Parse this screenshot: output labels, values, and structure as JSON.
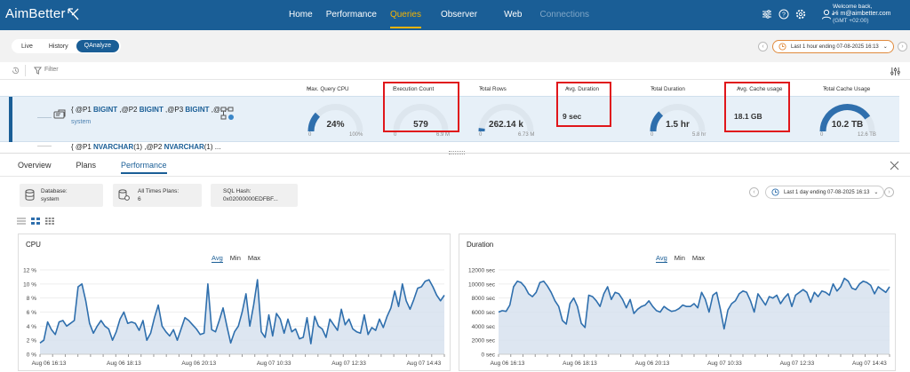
{
  "app": {
    "logo": "AimBetter"
  },
  "nav": [
    {
      "label": "Home"
    },
    {
      "label": "Performance"
    },
    {
      "label": "Queries"
    },
    {
      "label": "Observer"
    },
    {
      "label": "Web"
    },
    {
      "label": "Connections"
    }
  ],
  "user": {
    "welcome": "Welcome back,",
    "name": "Hi m@aimbetter.com",
    "tz": "(GMT +02:00)"
  },
  "tabs": [
    {
      "label": "Live"
    },
    {
      "label": "History"
    },
    {
      "label": "QAnalyze"
    }
  ],
  "time_range": "Last 1 hour ending  07-08-2025 16:13",
  "filter_label": "Filter",
  "columns": [
    "Max. Query CPU",
    "Execution Count",
    "Total Rows",
    "Avg. Duration",
    "Total Duration",
    "Avg. Cache usage",
    "Total Cache Usage"
  ],
  "row1": {
    "q1": "{ @P1 ",
    "k1": "BIGINT",
    "q2": " ,@P2 ",
    "k2": "BIGINT",
    "q3": " ,@P3 ",
    "k3": "BIGINT",
    "q4": " ,@...",
    "db": "system",
    "cpu": {
      "value": "24%",
      "min": "0",
      "max": "100%",
      "fraction": 0.24
    },
    "exec": {
      "value": "579",
      "min": "0",
      "max": "6.9 M",
      "fraction": 0.0
    },
    "rows": {
      "value": "262.14 k",
      "min": "0",
      "max": "6.73 M",
      "fraction": 0.04
    },
    "avgdur": {
      "value": "9 sec"
    },
    "totdur": {
      "value": "1.5 hr",
      "min": "0",
      "max": "5.8 hr",
      "fraction": 0.26
    },
    "avgcache": {
      "value": "18.1 GB"
    },
    "totcache": {
      "value": "10.2 TB",
      "min": "0",
      "max": "12.6 TB",
      "fraction": 0.81
    }
  },
  "row2": {
    "q1": "{ @P1 ",
    "k1": "NVARCHAR",
    "q2": "(1) ,@P2 ",
    "k2": "NVARCHAR",
    "q3": "(1) ..."
  },
  "panel": {
    "tabs": [
      {
        "label": "Overview"
      },
      {
        "label": "Plans"
      },
      {
        "label": "Performance"
      }
    ],
    "db_label": "Database:",
    "db_value": "system",
    "plans_label": "All Times Plans:",
    "plans_value": "6",
    "hash_label": "SQL Hash:",
    "hash_value": "0x02000000EDFBF...",
    "range": "Last 1 day ending  07-08-2025 16:13"
  },
  "charts": [
    {
      "title": "CPU",
      "tabs": [
        "Avg",
        "Min",
        "Max"
      ]
    },
    {
      "title": "Duration",
      "tabs": [
        "Avg",
        "Min",
        "Max"
      ]
    }
  ],
  "chart_data": [
    {
      "type": "area",
      "title": "CPU",
      "series": [
        {
          "values": [
            1.6,
            2,
            4.6,
            3.5,
            2.8,
            4.6,
            4.8,
            4,
            4.4,
            4.8,
            9.6,
            10,
            7.6,
            4.4,
            3,
            4,
            4.8,
            4,
            3.6,
            2,
            3.2,
            5,
            6,
            4.4,
            4.6,
            4.4,
            3.4,
            4.8,
            2,
            3,
            5.2,
            7,
            4,
            3.2,
            2.6,
            3.5,
            2,
            3.6,
            5.2,
            4.8,
            4.2,
            3.6,
            2.8,
            3,
            10,
            3.5,
            3.2,
            4.8,
            6.6,
            4,
            1.6,
            3.2,
            4,
            6,
            8.6,
            4,
            7,
            10.6,
            3.2,
            2.4,
            5.6,
            2.6,
            5.8,
            5,
            3,
            5,
            3.2,
            3.6,
            2.2,
            2.4,
            5.2,
            1.5,
            5.4,
            4,
            3.6,
            2.4,
            5,
            4.2,
            3.4,
            6.4,
            4.2,
            5,
            3.6,
            3.2,
            3,
            5.6,
            2.8,
            3.8,
            3.4,
            5,
            3.8,
            5.4,
            6.6,
            9,
            6.8,
            10,
            7.6,
            6.4,
            7.8,
            9.4,
            9.6,
            10.4,
            10.6,
            9.6,
            8.4,
            7.6,
            8.4
          ]
        }
      ],
      "xlabels": [
        "Aug 06 16:13",
        "Aug 06 18:13",
        "Aug 06 20:13",
        "Aug 07 10:33",
        "Aug 07 12:33",
        "Aug 07 14:43"
      ],
      "ylabels": [
        "0 %",
        "2 %",
        "4 %",
        "6 %",
        "8 %",
        "10 %",
        "12 %"
      ],
      "ylim": [
        0,
        12
      ]
    },
    {
      "type": "area",
      "title": "Duration",
      "series": [
        {
          "values": [
            6000,
            6200,
            6100,
            7000,
            9600,
            10400,
            10200,
            9600,
            8600,
            8200,
            8800,
            10200,
            10400,
            9700,
            8800,
            7600,
            6800,
            4800,
            4300,
            7200,
            8000,
            6800,
            4400,
            3800,
            8400,
            8200,
            7600,
            6800,
            8600,
            9600,
            7800,
            8800,
            8600,
            7800,
            6600,
            7800,
            5800,
            6400,
            6800,
            7000,
            7600,
            6800,
            6200,
            6000,
            6800,
            6400,
            6100,
            6200,
            6500,
            7000,
            6800,
            6800,
            7200,
            6600,
            8800,
            7800,
            6000,
            8400,
            8800,
            6400,
            3600,
            6300,
            7200,
            7600,
            8600,
            9000,
            8800,
            7600,
            6000,
            8600,
            7800,
            7000,
            8200,
            8000,
            8400,
            7200,
            8000,
            8600,
            6800,
            8400,
            8800,
            9200,
            8800,
            7400,
            8800,
            8200,
            9000,
            8800,
            8400,
            10000,
            9000,
            9600,
            10800,
            10400,
            9400,
            9200,
            10000,
            10400,
            10200,
            9800,
            8600,
            9600,
            9200,
            8800,
            9600
          ]
        }
      ],
      "xlabels": [
        "Aug 06 16:13",
        "Aug 06 18:13",
        "Aug 06 20:13",
        "Aug 07 10:33",
        "Aug 07 12:33",
        "Aug 07 14:43"
      ],
      "ylabels": [
        "0 sec",
        "2000 sec",
        "4000 sec",
        "6000 sec",
        "8000 sec",
        "10000 sec",
        "12000 sec"
      ],
      "ylim": [
        0,
        12000
      ]
    }
  ]
}
